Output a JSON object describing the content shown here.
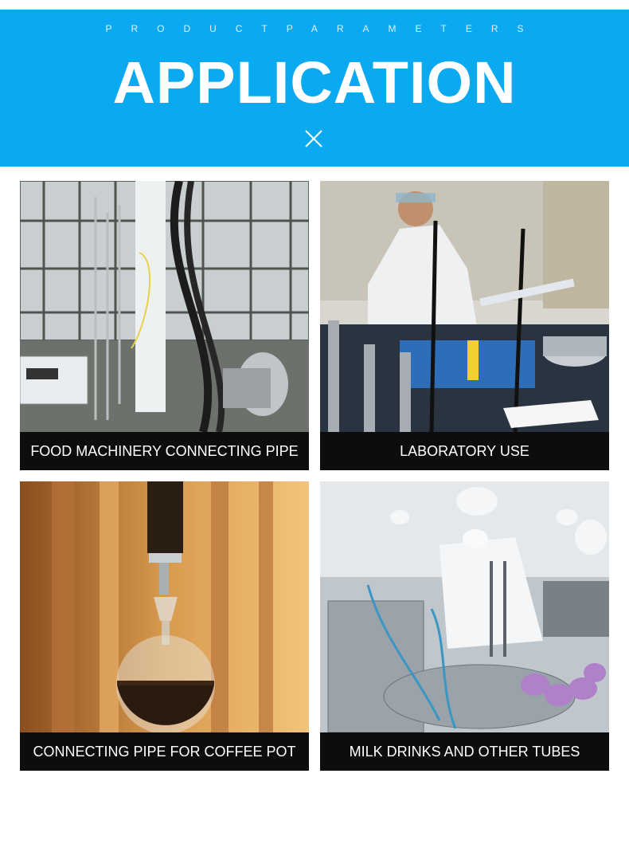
{
  "header": {
    "subtitle": "PRODUCTPARAMETERS",
    "title": "APPLICATION",
    "accent_color": "#0aa9f0",
    "icon": "close-x-icon"
  },
  "applications": [
    {
      "caption": "FOOD MACHINERY CONNECTING PIPE"
    },
    {
      "caption": "LABORATORY USE"
    },
    {
      "caption": "CONNECTING PIPE FOR COFFEE POT"
    },
    {
      "caption": "MILK DRINKS AND OTHER TUBES"
    }
  ]
}
